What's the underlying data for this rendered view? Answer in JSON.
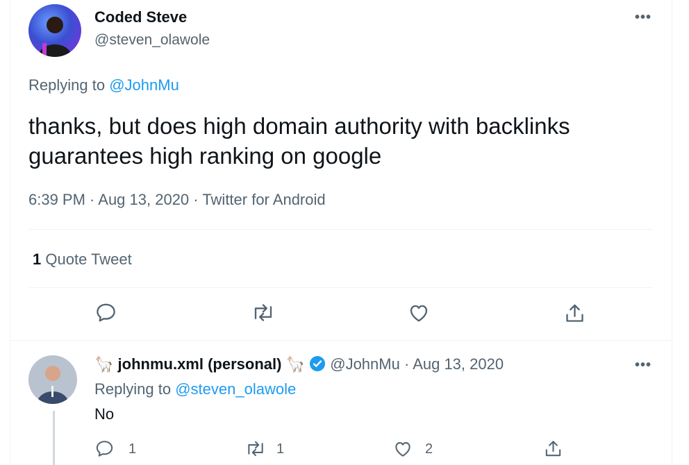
{
  "main_tweet": {
    "author_name": "Coded Steve",
    "author_handle": "@steven_olawole",
    "replying_prefix": "Replying to",
    "replying_to": "@JohnMu",
    "text_line1": "thanks, but does high domain authority with backlinks",
    "text_line2": "guarantees high ranking on google",
    "timestamp": "6:39 PM · Aug 13, 2020 · Twitter for Android",
    "quote_count": "1",
    "quote_label": "Quote Tweet"
  },
  "reply_tweet": {
    "author_name": "johnmu.xml (personal)",
    "name_emoji": "🦙",
    "author_handle": "@JohnMu",
    "date": "· Aug 13, 2020",
    "replying_prefix": "Replying to",
    "replying_to": "@steven_olawole",
    "text": "No",
    "reply_count": "1",
    "retweet_count": "1",
    "like_count": "2"
  },
  "more_glyph": "•••",
  "colors": {
    "accent": "#1d9bf0",
    "secondary_text": "#536471",
    "divider": "#eff3f4"
  }
}
